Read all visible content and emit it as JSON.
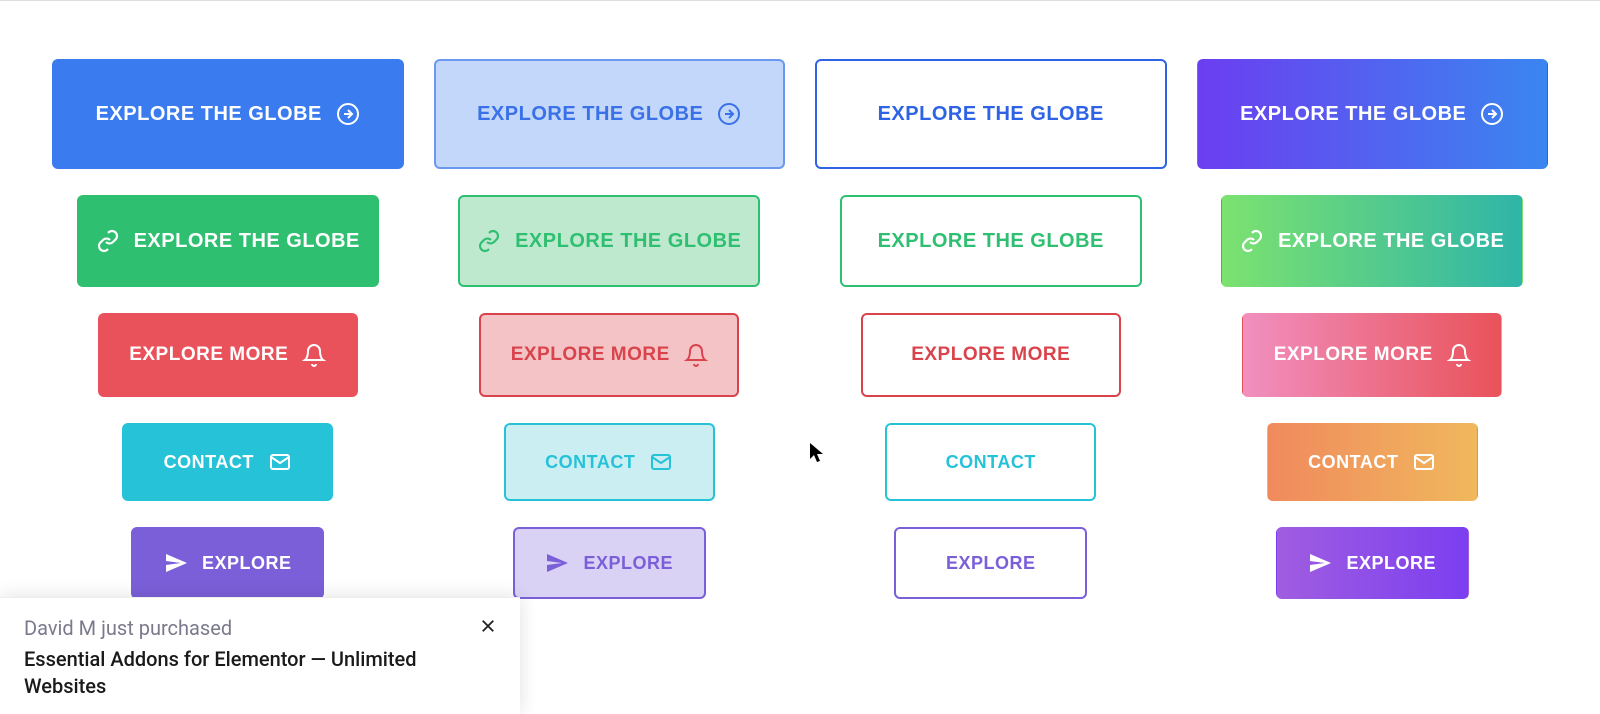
{
  "buttons": {
    "explore_globe": "EXPLORE THE GLOBE",
    "explore_more": "EXPLORE MORE",
    "contact": "CONTACT",
    "explore": "EXPLORE"
  },
  "toast": {
    "line1": "David M just purchased",
    "line2": "Essential Addons for Elementor — Unlimited Websites"
  }
}
